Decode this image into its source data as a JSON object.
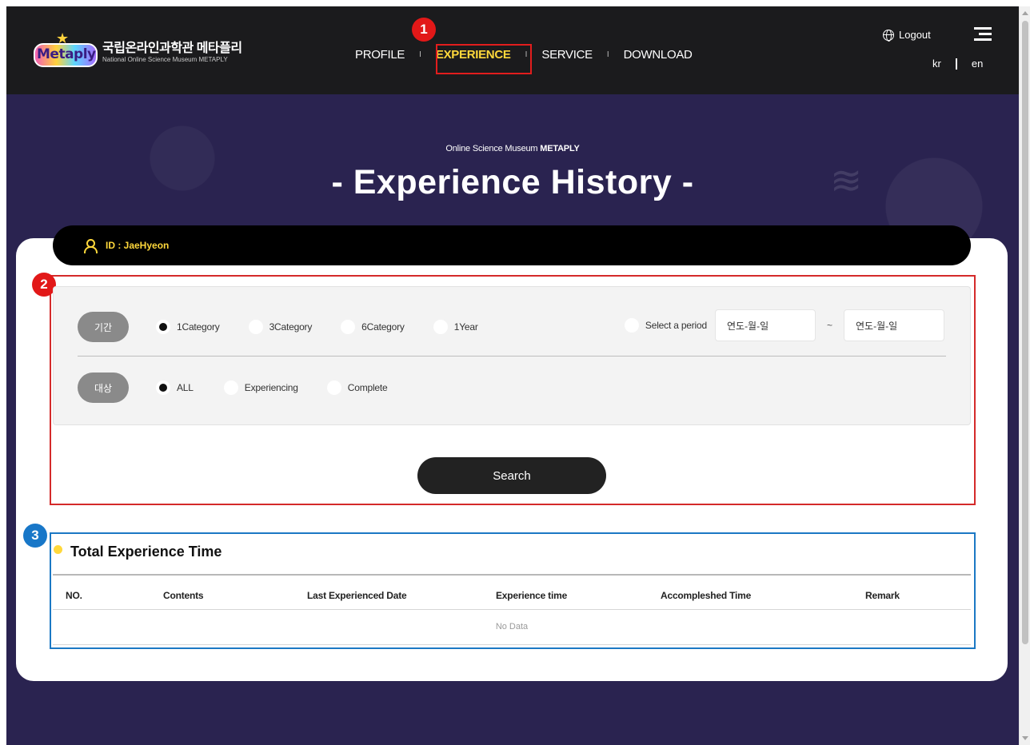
{
  "header": {
    "logo_kr": "국립온라인과학관 메타플리",
    "logo_en": "National Online Science Museum METAPLY",
    "logo_mark": "Metaply",
    "nav": [
      {
        "label": "PROFILE",
        "active": false
      },
      {
        "label": "EXPERIENCE",
        "active": true
      },
      {
        "label": "SERVICE",
        "active": false
      },
      {
        "label": "DOWNLOAD",
        "active": false
      }
    ],
    "logout": "Logout",
    "lang_kr": "kr",
    "lang_en": "en"
  },
  "annotations": {
    "one": "1",
    "two": "2",
    "three": "3"
  },
  "hero": {
    "subtitle_prefix": "Online Science Museum ",
    "subtitle_brand": "METAPLY",
    "title": "- Experience History -"
  },
  "user": {
    "id_label": "ID : JaeHyeon"
  },
  "filters": {
    "period_label": "기간",
    "period_options": [
      {
        "label": "1Category",
        "checked": true
      },
      {
        "label": "3Category",
        "checked": false
      },
      {
        "label": "6Category",
        "checked": false
      },
      {
        "label": "1Year",
        "checked": false
      }
    ],
    "select_period_label": "Select a period",
    "date_from_placeholder": "연도-월-일",
    "date_to_placeholder": "연도-월-일",
    "date_separator": "~",
    "target_label": "대상",
    "target_options": [
      {
        "label": "ALL",
        "checked": true
      },
      {
        "label": "Experiencing",
        "checked": false
      },
      {
        "label": "Complete",
        "checked": false
      }
    ],
    "search_button": "Search"
  },
  "table": {
    "title": "Total Experience Time",
    "columns": [
      "NO.",
      "Contents",
      "Last Experienced Date",
      "Experience time",
      "Accompleshed Time",
      "Remark"
    ],
    "empty_text": "No Data"
  },
  "colors": {
    "accent_yellow": "#ffd83b",
    "annotation_red": "#e21818",
    "annotation_blue": "#1877c8",
    "hero_bg": "#2a2350",
    "header_bg": "#1b1b1d"
  }
}
